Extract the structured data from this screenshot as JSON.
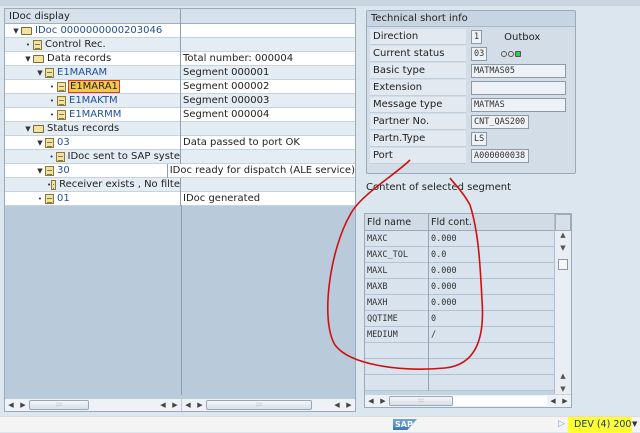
{
  "tree": {
    "header": "IDoc display",
    "rows": [
      {
        "label": "IDoc 0000000000203046",
        "value": "",
        "level": 0,
        "type": "folder",
        "expanded": true,
        "blue": true
      },
      {
        "label": "Control Rec.",
        "value": "",
        "level": 1,
        "type": "doc"
      },
      {
        "label": "Data records",
        "value": "Total number: 000004",
        "level": 1,
        "type": "folder",
        "expanded": true
      },
      {
        "label": "E1MARAM",
        "value": "Segment 000001",
        "level": 2,
        "type": "doc",
        "expanded": true,
        "blue": true
      },
      {
        "label": "E1MARA1",
        "value": "Segment 000002",
        "level": 3,
        "type": "doc",
        "selected": true
      },
      {
        "label": "E1MAKTM",
        "value": "Segment 000003",
        "level": 3,
        "type": "doc",
        "blue": true
      },
      {
        "label": "E1MARMM",
        "value": "Segment 000004",
        "level": 3,
        "type": "doc",
        "blue": true
      },
      {
        "label": "Status records",
        "value": "",
        "level": 1,
        "type": "folder",
        "expanded": true
      },
      {
        "label": "03",
        "value": "Data passed to port OK",
        "level": 2,
        "type": "doc",
        "expanded": true,
        "blue": true
      },
      {
        "label": "IDoc sent to SAP syste",
        "value": "",
        "level": 3,
        "type": "doc"
      },
      {
        "label": "30",
        "value": "IDoc ready for dispatch (ALE service)",
        "level": 2,
        "type": "doc",
        "expanded": true,
        "blue": true
      },
      {
        "label": "Receiver exists , No filte",
        "value": "",
        "level": 3,
        "type": "doc"
      },
      {
        "label": "01",
        "value": "IDoc generated",
        "level": 2,
        "type": "doc",
        "blue": true
      }
    ]
  },
  "info": {
    "title": "Technical short info",
    "direction_label": "Direction",
    "direction": "1",
    "direction_text": "Outbox",
    "status_label": "Current status",
    "status": "03",
    "basic_type_label": "Basic type",
    "basic_type": "MATMAS05",
    "extension_label": "Extension",
    "extension": "",
    "message_type_label": "Message type",
    "message_type": "MATMAS",
    "partner_no_label": "Partner No.",
    "partner_no": "CNT_QAS200",
    "partn_type_label": "Partn.Type",
    "partn_type": "LS",
    "port_label": "Port",
    "port": "A000000038"
  },
  "segment": {
    "caption": "Content of selected segment",
    "col_name": "Fld name",
    "col_value": "Fld cont.",
    "rows": [
      {
        "name": "MAXC",
        "value": "0.000"
      },
      {
        "name": "MAXC_TOL",
        "value": "0.0"
      },
      {
        "name": "MAXL",
        "value": "0.000"
      },
      {
        "name": "MAXB",
        "value": "0.000"
      },
      {
        "name": "MAXH",
        "value": "0.000"
      },
      {
        "name": "QQTIME",
        "value": "0"
      },
      {
        "name": "MEDIUM",
        "value": "/"
      },
      {
        "name": "",
        "value": ""
      },
      {
        "name": "",
        "value": ""
      },
      {
        "name": "",
        "value": ""
      }
    ]
  },
  "status": {
    "logo": "SAP",
    "system": "DEV (4) 200"
  },
  "colors": {
    "annotation": "#cc1111",
    "highlight": "#ffff33",
    "status_green": "#2ecc40"
  }
}
